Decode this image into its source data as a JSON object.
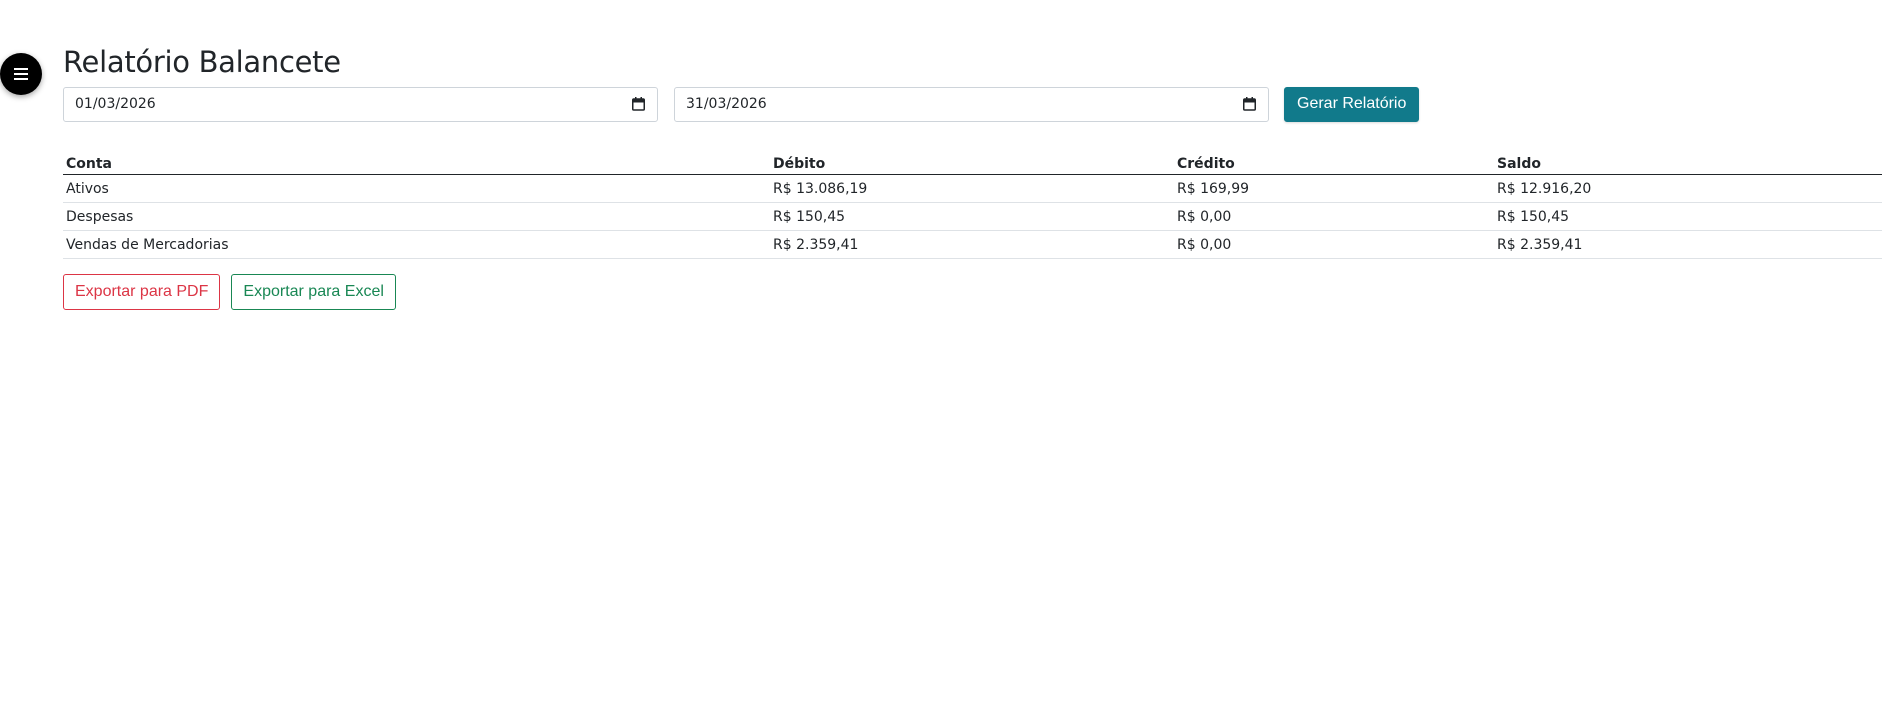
{
  "menu": {
    "icon": "hamburger-icon"
  },
  "page": {
    "title": "Relatório Balancete"
  },
  "filters": {
    "start_date": "01/03/2026",
    "end_date": "31/03/2026",
    "generate_label": "Gerar Relatório"
  },
  "table": {
    "headers": [
      "Conta",
      "Débito",
      "Crédito",
      "Saldo"
    ],
    "rows": [
      {
        "conta": "Ativos",
        "debito": "R$ 13.086,19",
        "credito": "R$ 169,99",
        "saldo": "R$ 12.916,20"
      },
      {
        "conta": "Despesas",
        "debito": "R$ 150,45",
        "credito": "R$ 0,00",
        "saldo": "R$ 150,45"
      },
      {
        "conta": "Vendas de Mercadorias",
        "debito": "R$ 2.359,41",
        "credito": "R$ 0,00",
        "saldo": "R$ 2.359,41"
      }
    ]
  },
  "export": {
    "pdf_label": "Exportar para PDF",
    "excel_label": "Exportar para Excel"
  },
  "colors": {
    "primary_teal": "#117a8b",
    "danger": "#dc3545",
    "success": "#198754"
  }
}
